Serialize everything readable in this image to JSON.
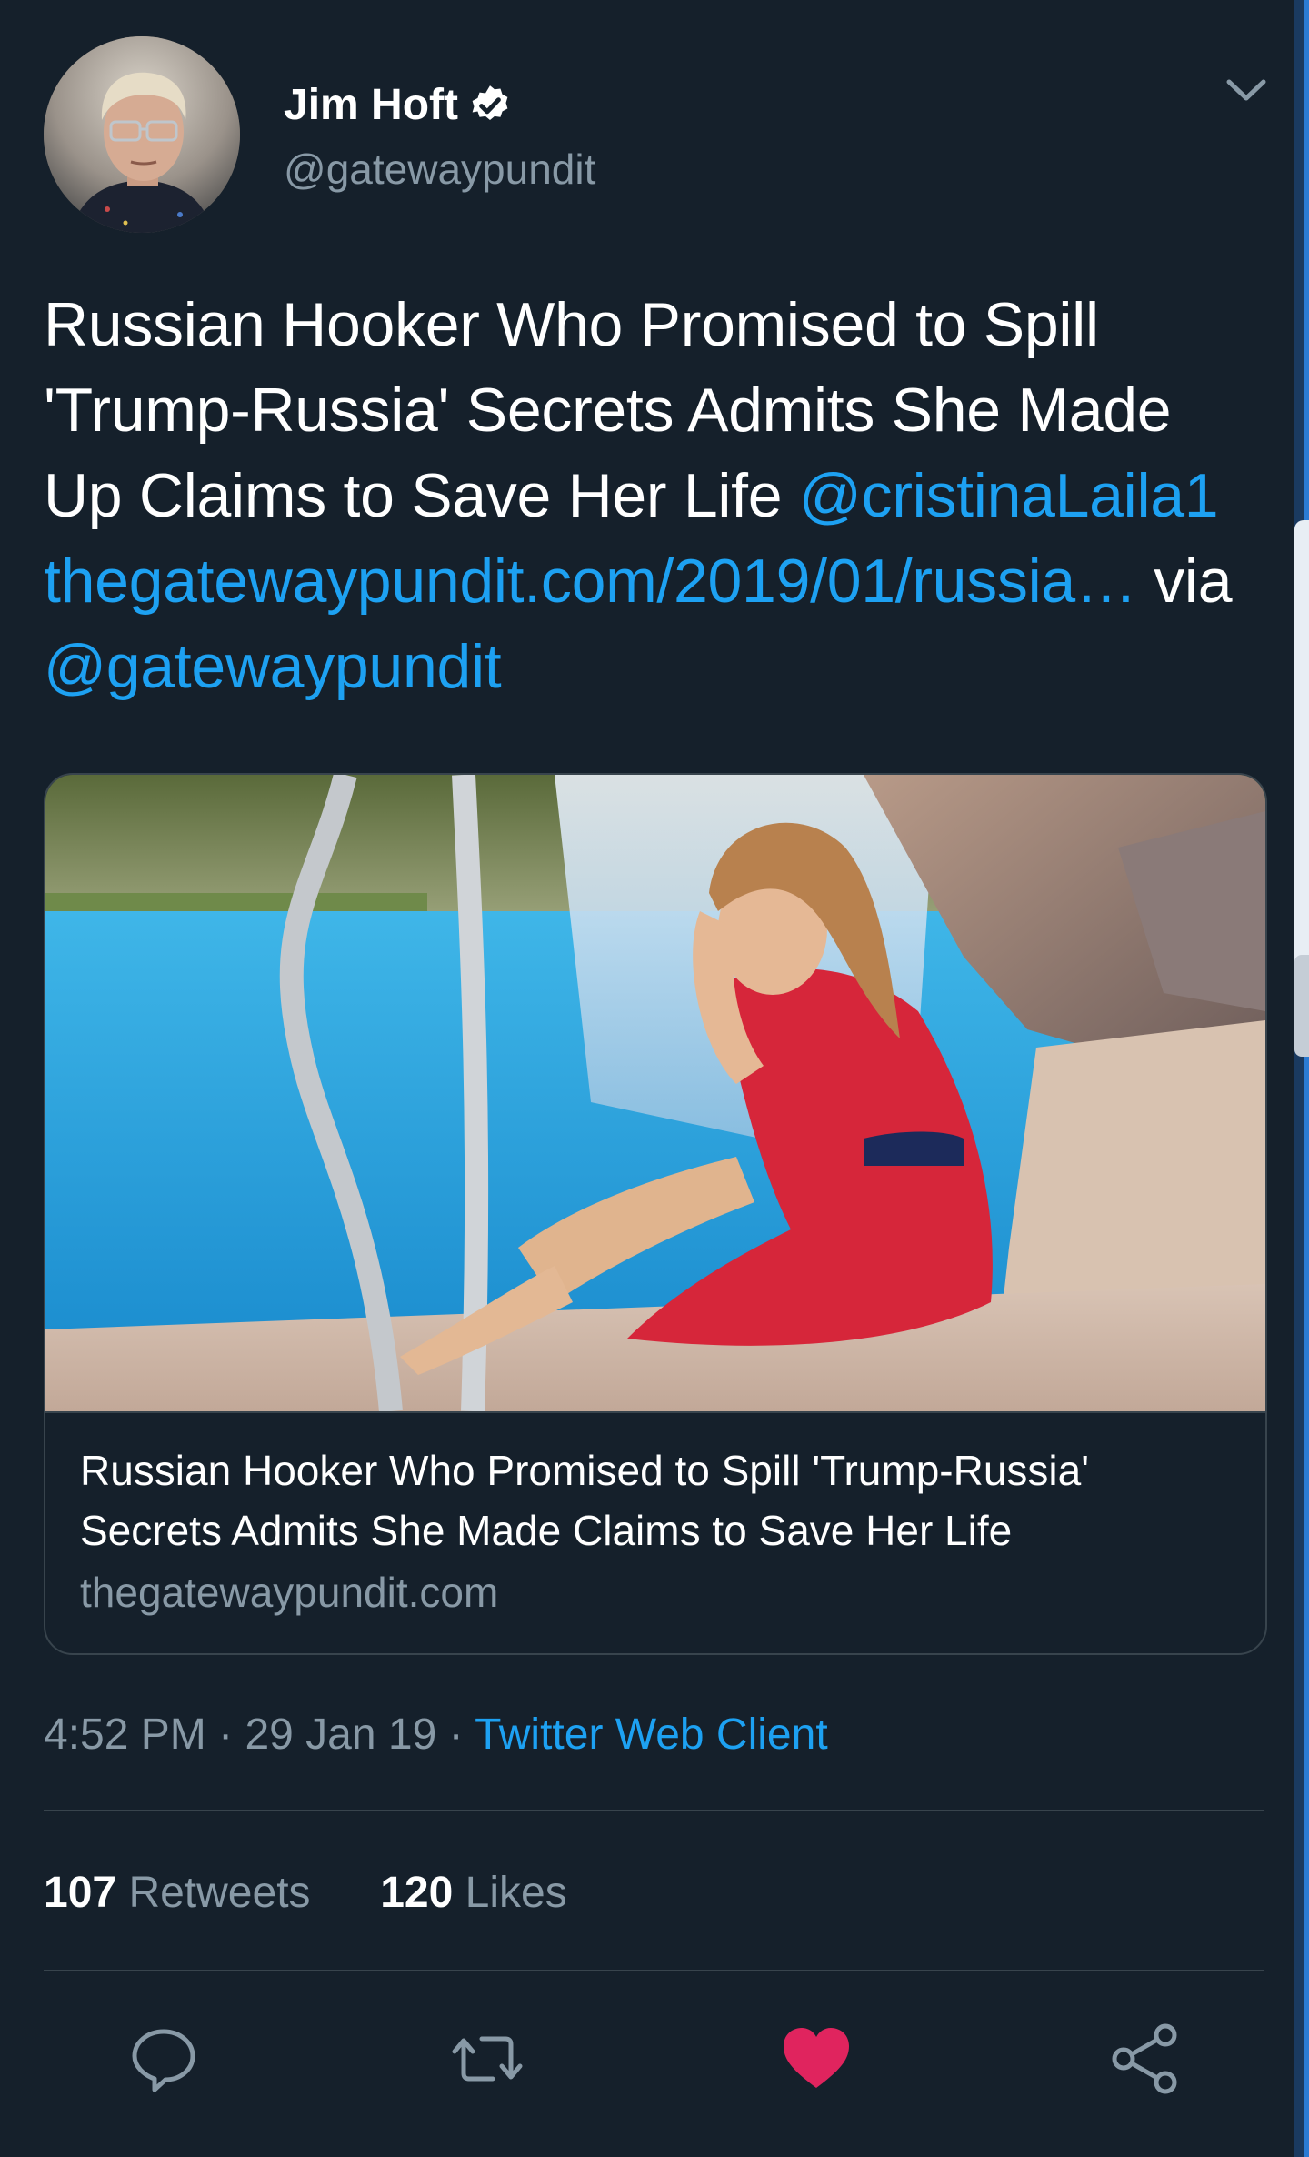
{
  "tweet": {
    "author": {
      "name": "Jim Hoft",
      "handle": "@gatewaypundit",
      "verified": true
    },
    "text": {
      "body": "Russian Hooker Who Promised to Spill 'Trump-Russia' Secrets Admits She Made Up Claims to Save Her Life",
      "mention": "@cristinaLaila1",
      "url": "thegatewaypundit.com/2019/01/russia…",
      "via": "via",
      "via_mention": "@gatewaypundit"
    },
    "card": {
      "title": "Russian Hooker Who Promised to Spill 'Trump-Russia' Secrets Admits She Made Claims to Save Her Life",
      "domain": "thegatewaypundit.com"
    },
    "meta": {
      "time": "4:52 PM",
      "separator": "·",
      "date": "29 Jan 19",
      "source": "Twitter Web Client"
    },
    "stats": {
      "retweets_count": "107",
      "retweets_label": "Retweets",
      "likes_count": "120",
      "likes_label": "Likes"
    },
    "actions": {
      "liked": true
    }
  },
  "colors": {
    "background": "#15202b",
    "link": "#1da1f2",
    "secondary_text": "#8899a6",
    "divider": "#38444d",
    "like": "#e0245e"
  },
  "icons": {
    "verified": "verified-badge-icon",
    "caret": "chevron-down-icon",
    "reply": "reply-icon",
    "retweet": "retweet-icon",
    "like": "heart-icon",
    "share": "share-icon"
  }
}
